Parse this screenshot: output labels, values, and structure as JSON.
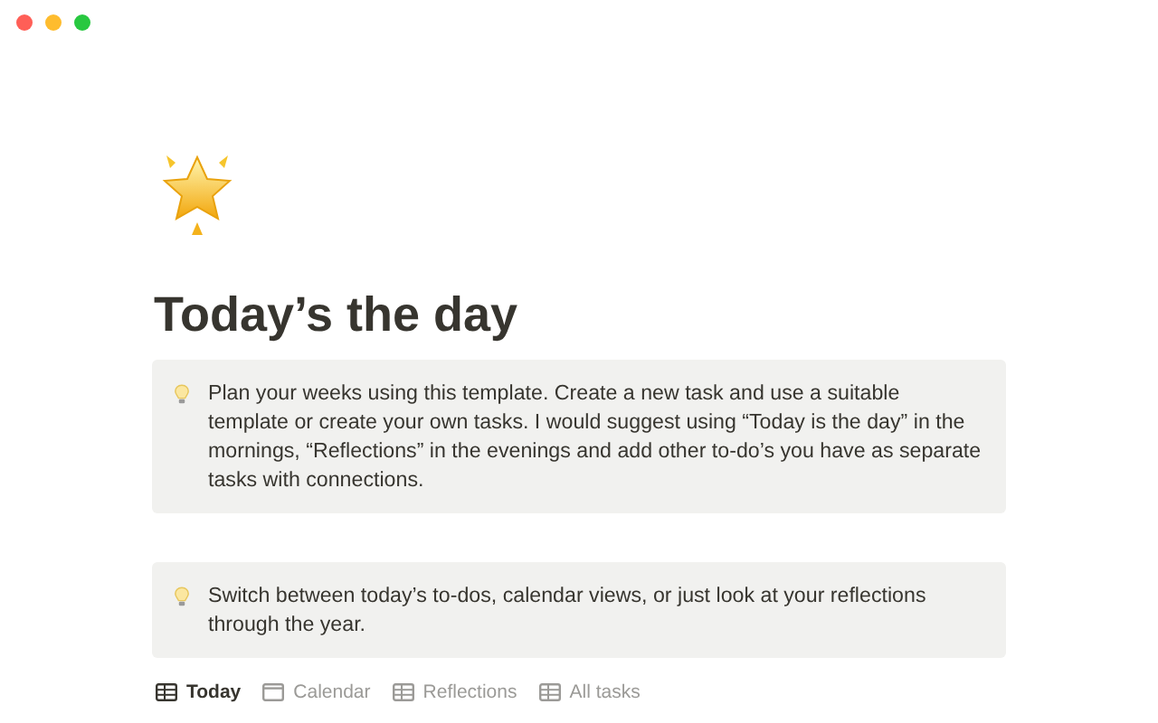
{
  "window": {
    "controls": [
      {
        "color": "#ff5f57"
      },
      {
        "color": "#febc2e"
      },
      {
        "color": "#28c840"
      }
    ]
  },
  "page": {
    "title": "Today’s the day"
  },
  "callouts": [
    {
      "text": "Plan your weeks using this template. Create a new task and use a suitable template or create your own tasks. I would suggest using “Today is the day” in the mornings, “Reflections” in the evenings and add other to-do’s you have as separate tasks with connections."
    },
    {
      "text": "Switch between today’s to-dos, calendar views, or just look at your reflections through the year."
    }
  ],
  "views": [
    {
      "label": "Today",
      "kind": "table",
      "selected": true
    },
    {
      "label": "Calendar",
      "kind": "calendar",
      "selected": false
    },
    {
      "label": "Reflections",
      "kind": "table",
      "selected": false
    },
    {
      "label": "All tasks",
      "kind": "table",
      "selected": false
    }
  ]
}
